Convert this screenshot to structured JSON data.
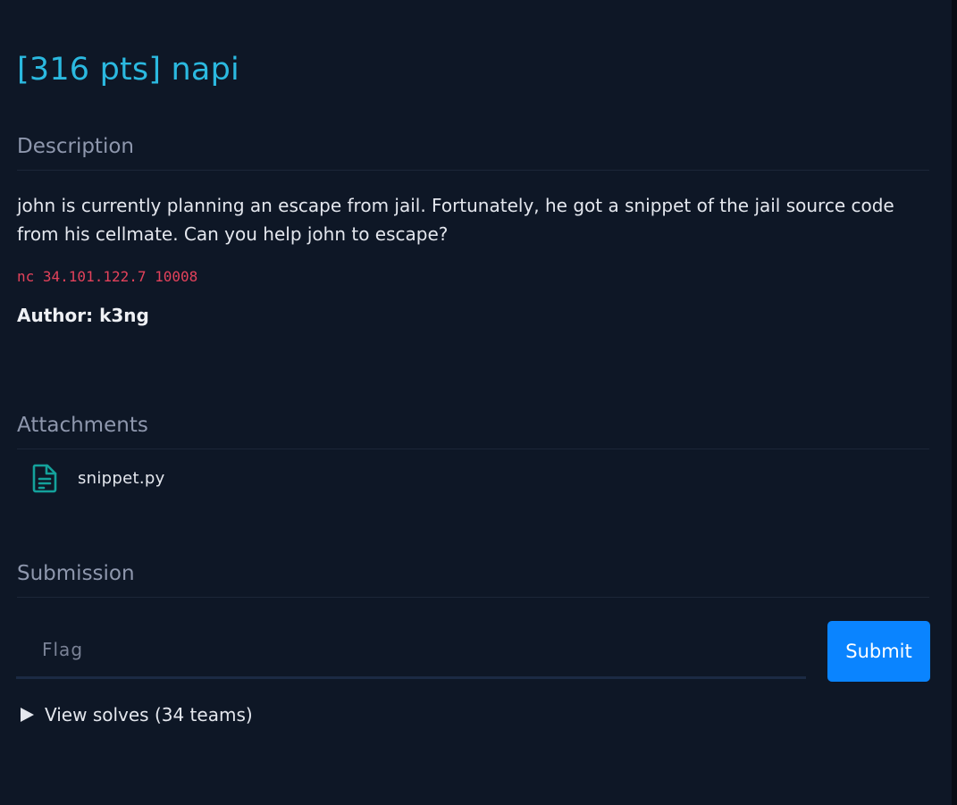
{
  "challenge": {
    "title": "[316 pts] napi"
  },
  "description": {
    "heading": "Description",
    "text": "john is currently planning an escape from jail. Fortunately, he got a snippet of the jail source code from his cellmate. Can you help john to escape?",
    "command": "nc 34.101.122.7 10008",
    "author": "Author: k3ng"
  },
  "attachments": {
    "heading": "Attachments",
    "items": [
      {
        "name": "snippet.py",
        "icon": "file-text-icon"
      }
    ]
  },
  "submission": {
    "heading": "Submission",
    "flag_placeholder": "Flag",
    "flag_value": "",
    "submit_label": "Submit"
  },
  "solves": {
    "label": "View solves (34 teams)",
    "icon": "triangle-right-icon"
  },
  "colors": {
    "background": "#0e1726",
    "title": "#2bb9e0",
    "section_heading": "#8e97ad",
    "command": "#e3425b",
    "file_icon": "#14a19b",
    "submit": "#0a84ff"
  }
}
